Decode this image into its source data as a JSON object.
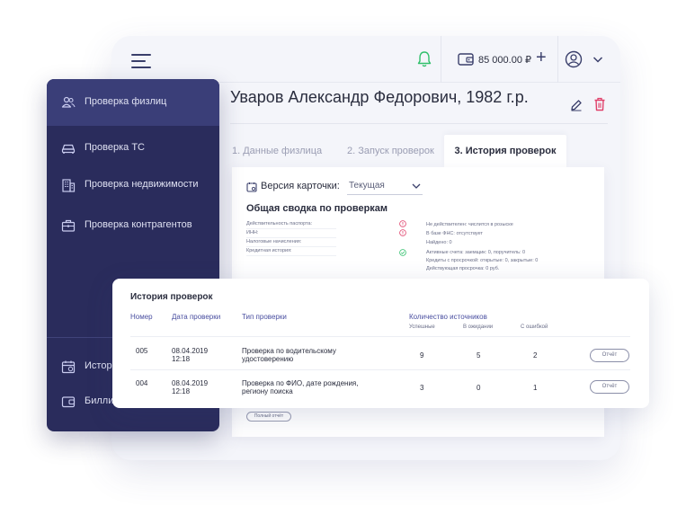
{
  "header": {
    "balance": "85 000.00 ₽",
    "plus": "+"
  },
  "person": {
    "title": "Уваров Александр Федорович, 1982 г.р."
  },
  "tabs": [
    {
      "label": "1. Данные физлица"
    },
    {
      "label": "2. Запуск проверок"
    },
    {
      "label": "3. История проверок",
      "active": true
    }
  ],
  "card": {
    "version_label": "Версия карточки:",
    "version_value": "Текущая",
    "summary_title": "Общая сводка по проверкам",
    "rows": [
      {
        "label": "Действительность паспорта:",
        "status": "warning",
        "value": "Не действителен: числится в розыске"
      },
      {
        "label": "ИНН:",
        "status": "warning",
        "value": "В базе ФНС: отсутствует"
      },
      {
        "label": "Налоговые начисления:",
        "status": "none",
        "value": "Найдено: 0"
      },
      {
        "label": "Кредитная история:",
        "status": "ok",
        "value": "Активные счета: заемщик: 0, поручитель: 0",
        "value2": "Кредиты с просрочкой: открытые: 0, закрытые: 0",
        "value3": "Действующая просрочка: 0 руб."
      }
    ],
    "full_report": "Полный отчёт"
  },
  "sidebar": {
    "items": [
      {
        "label": "Проверка физлиц",
        "icon": "users-icon",
        "active": true
      },
      {
        "label": "Проверка ТС",
        "icon": "car-icon"
      },
      {
        "label": "Проверка недвижимости",
        "icon": "building-icon"
      },
      {
        "label": "Проверка контрагентов",
        "icon": "briefcase-icon"
      },
      {
        "label": "Истор",
        "icon": "calendar-icon"
      },
      {
        "label": "Билли",
        "icon": "wallet-icon"
      }
    ]
  },
  "history": {
    "title": "История проверок",
    "columns": {
      "number": "Номер",
      "date": "Дата проверки",
      "type": "Тип проверки",
      "sources": "Количество источников",
      "success": "Успешные",
      "waiting": "В ожидании",
      "error": "С ошибкой"
    },
    "rows": [
      {
        "number": "005",
        "date": "08.04.2019",
        "time": "12:18",
        "type": "Проверка по водительскому",
        "type2": "удостоверению",
        "success": "9",
        "waiting": "5",
        "error": "2",
        "report": "Отчёт"
      },
      {
        "number": "004",
        "date": "08.04.2019",
        "time": "12:18",
        "type": "Проверка по ФИО, дате рождения,",
        "type2": "региону поиска",
        "success": "3",
        "waiting": "0",
        "error": "1",
        "report": "Отчёт"
      }
    ]
  },
  "colors": {
    "sidebar": "#2a2c5c",
    "accent": "#4a4fa0",
    "bell": "#2fbf6a",
    "danger": "#e0406a",
    "ok": "#2fbf6a"
  }
}
